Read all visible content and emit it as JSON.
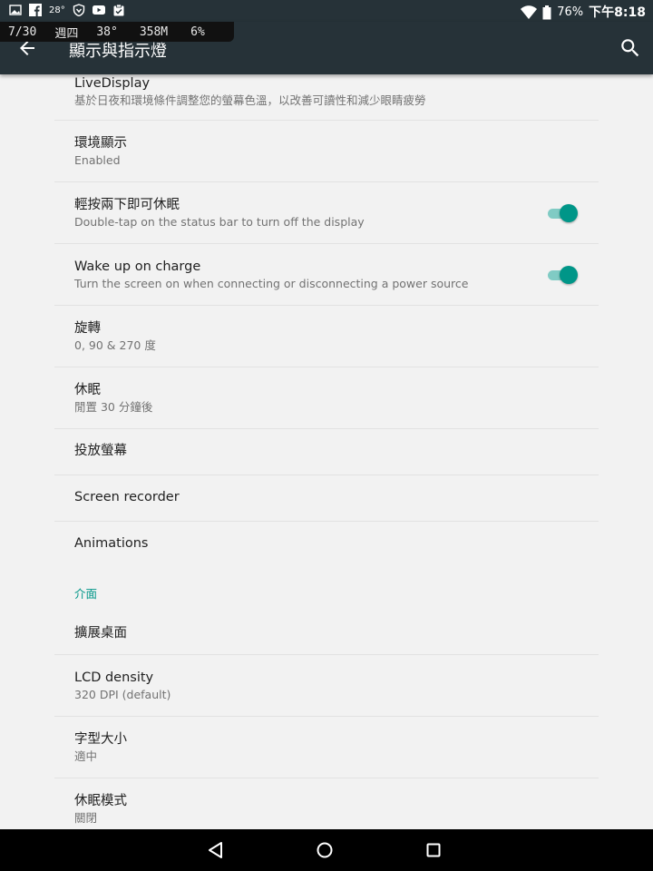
{
  "status_bar": {
    "temperature": "28°",
    "battery": "76%",
    "time": "下午8:18"
  },
  "monitor": {
    "date": "7/30",
    "weekday": "週四",
    "temp": "38°",
    "memory": "358M",
    "cpu": "6%"
  },
  "app_bar": {
    "title": "顯示與指示燈"
  },
  "colors": {
    "app_bar": "#263238",
    "accent": "#009688",
    "background": "#f2f2f2"
  },
  "settings": [
    {
      "title": "LiveDisplay",
      "summary": "基於日夜和環境條件調整您的螢幕色溫，以改善可讀性和減少眼睛疲勞"
    },
    {
      "title": "環境顯示",
      "summary": "Enabled"
    },
    {
      "title": "輕按兩下即可休眠",
      "summary": "Double-tap on the status bar to turn off the display",
      "toggle_on": true
    },
    {
      "title": "Wake up on charge",
      "summary": "Turn the screen on when connecting or disconnecting a power source",
      "toggle_on": true
    },
    {
      "title": "旋轉",
      "summary": "0, 90 & 270 度"
    },
    {
      "title": "休眠",
      "summary": "閒置 30 分鐘後"
    },
    {
      "title": "投放螢幕"
    },
    {
      "title": "Screen recorder"
    },
    {
      "title": "Animations"
    }
  ],
  "category": {
    "title": "介面",
    "items": [
      {
        "title": "擴展桌面"
      },
      {
        "title": "LCD density",
        "summary": "320 DPI (default)"
      },
      {
        "title": "字型大小",
        "summary": "適中"
      },
      {
        "title": "休眠模式",
        "summary": "關閉"
      }
    ]
  },
  "icons": [
    "gallery-icon",
    "facebook-icon",
    "shield-icon",
    "youtube-icon",
    "clipboard-icon",
    "wifi-icon",
    "battery-icon",
    "back-arrow-icon",
    "search-icon",
    "nav-back-icon",
    "nav-home-icon",
    "nav-recents-icon"
  ]
}
